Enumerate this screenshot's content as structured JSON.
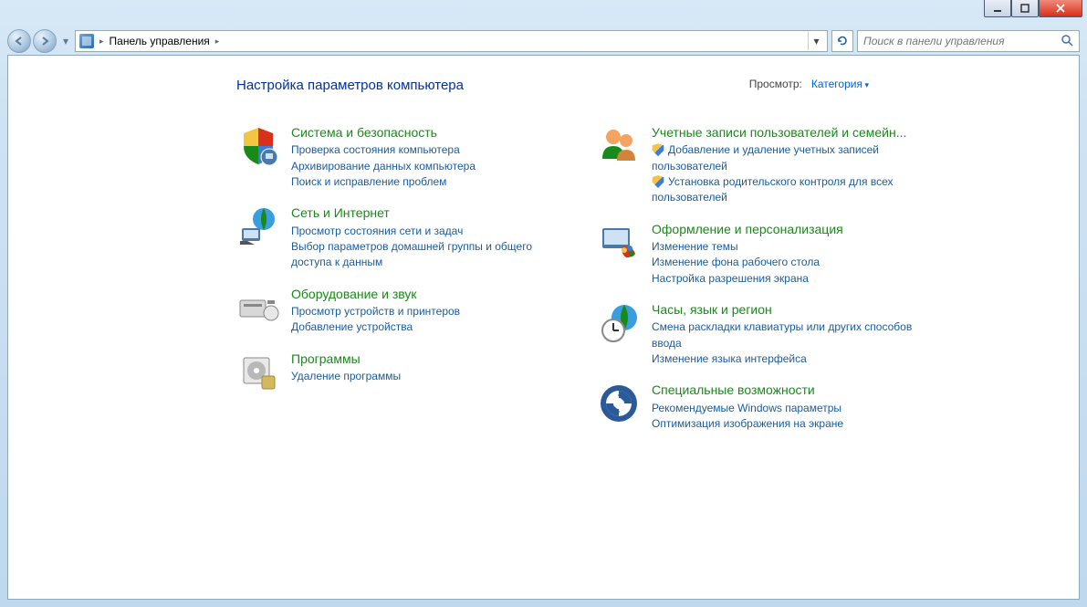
{
  "window": {
    "minimize": "━",
    "maximize": "▣",
    "close": "✕"
  },
  "breadcrumb": {
    "root": "Панель управления"
  },
  "search": {
    "placeholder": "Поиск в панели управления"
  },
  "page": {
    "title": "Настройка параметров компьютера",
    "view_label": "Просмотр:",
    "view_value": "Категория"
  },
  "left": [
    {
      "title": "Система и безопасность",
      "icon": "shield-pc",
      "tasks": [
        {
          "label": "Проверка состояния компьютера",
          "shield": false
        },
        {
          "label": "Архивирование данных компьютера",
          "shield": false
        },
        {
          "label": "Поиск и исправление проблем",
          "shield": false
        }
      ]
    },
    {
      "title": "Сеть и Интернет",
      "icon": "network",
      "tasks": [
        {
          "label": "Просмотр состояния сети и задач",
          "shield": false
        },
        {
          "label": "Выбор параметров домашней группы и общего доступа к данным",
          "shield": false
        }
      ]
    },
    {
      "title": "Оборудование и звук",
      "icon": "hardware",
      "tasks": [
        {
          "label": "Просмотр устройств и принтеров",
          "shield": false
        },
        {
          "label": "Добавление устройства",
          "shield": false
        }
      ]
    },
    {
      "title": "Программы",
      "icon": "programs",
      "tasks": [
        {
          "label": "Удаление программы",
          "shield": false
        }
      ]
    }
  ],
  "right": [
    {
      "title": "Учетные записи пользователей и семейн...",
      "icon": "users",
      "tasks": [
        {
          "label": "Добавление и удаление учетных записей пользователей",
          "shield": true
        },
        {
          "label": "Установка родительского контроля для всех пользователей",
          "shield": true
        }
      ]
    },
    {
      "title": "Оформление и персонализация",
      "icon": "appearance",
      "tasks": [
        {
          "label": "Изменение темы",
          "shield": false
        },
        {
          "label": "Изменение фона рабочего стола",
          "shield": false
        },
        {
          "label": "Настройка разрешения экрана",
          "shield": false
        }
      ]
    },
    {
      "title": "Часы, язык и регион",
      "icon": "clock",
      "tasks": [
        {
          "label": "Смена раскладки клавиатуры или других способов ввода",
          "shield": false
        },
        {
          "label": "Изменение языка интерфейса",
          "shield": false
        }
      ]
    },
    {
      "title": "Специальные возможности",
      "icon": "ease",
      "tasks": [
        {
          "label": "Рекомендуемые Windows параметры",
          "shield": false
        },
        {
          "label": "Оптимизация изображения на экране",
          "shield": false
        }
      ]
    }
  ]
}
